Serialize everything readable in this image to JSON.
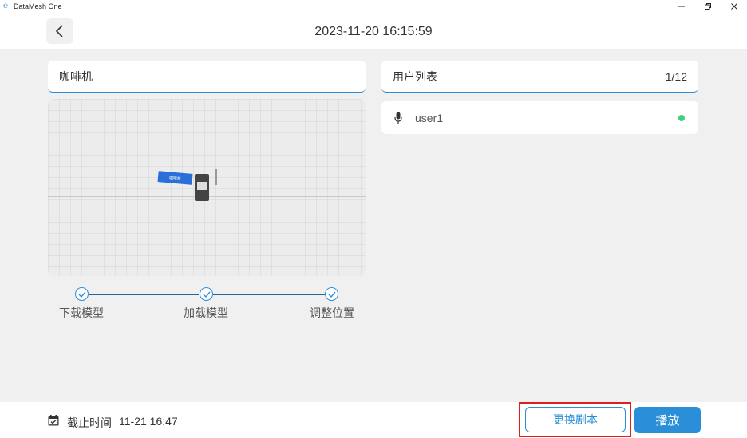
{
  "window": {
    "title": "DataMesh One",
    "controls": [
      "minimize",
      "restore",
      "close"
    ]
  },
  "header": {
    "datetime": "2023-11-20 16:15:59"
  },
  "model": {
    "name": "咖啡机",
    "viewport_label": "咖啡机"
  },
  "steps": [
    {
      "label": "下载模型",
      "done": true
    },
    {
      "label": "加载模型",
      "done": true
    },
    {
      "label": "调整位置",
      "done": true
    }
  ],
  "users": {
    "title": "用户列表",
    "count": "1/12",
    "items": [
      {
        "name": "user1",
        "status": "online"
      }
    ]
  },
  "footer": {
    "deadline_label": "截止时间",
    "deadline_value": "11-21 16:47",
    "change_script_label": "更换剧本",
    "play_label": "播放"
  },
  "colors": {
    "accent": "#2a8fd8",
    "online": "#3bd17f",
    "highlight": "#e01e1e"
  }
}
